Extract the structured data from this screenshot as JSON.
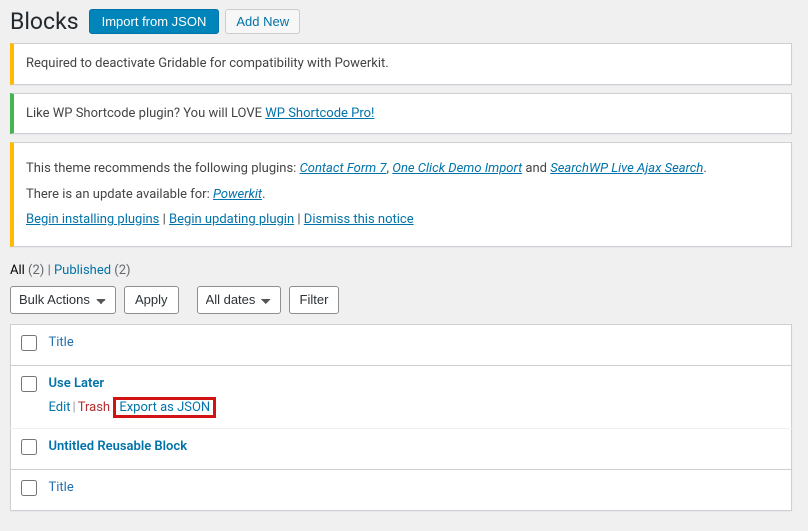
{
  "header": {
    "title": "Blocks",
    "import_btn": "Import from JSON",
    "add_new_btn": "Add New"
  },
  "notices": {
    "gridable": "Required to deactivate Gridable for compatibility with Powerkit.",
    "shortcode_pre": "Like WP Shortcode plugin? You will LOVE ",
    "shortcode_link": "WP Shortcode Pro!",
    "tgmpa": {
      "recommends_pre": "This theme recommends the following plugins: ",
      "plugin1": "Contact Form 7",
      "sep1": ", ",
      "plugin2": "One Click Demo Import",
      "and": " and ",
      "plugin3": "SearchWP Live Ajax Search",
      "period": ".",
      "update_pre": "There is an update available for: ",
      "update_link": "Powerkit",
      "update_period": ".",
      "action_install": "Begin installing plugins",
      "action_sep": " | ",
      "action_update": "Begin updating plugin",
      "action_dismiss": "Dismiss this notice"
    }
  },
  "views": {
    "all_label": "All",
    "all_count": "(2)",
    "sep": " | ",
    "published_label": "Published",
    "published_count": "(2)"
  },
  "tablenav": {
    "bulk": "Bulk Actions",
    "apply": "Apply",
    "dates": "All dates",
    "filter": "Filter"
  },
  "table": {
    "col_title": "Title",
    "rows": [
      {
        "title": "Use Later",
        "actions": {
          "edit": "Edit",
          "trash": "Trash",
          "export": "Export as JSON"
        }
      },
      {
        "title": "Untitled Reusable Block"
      }
    ]
  }
}
